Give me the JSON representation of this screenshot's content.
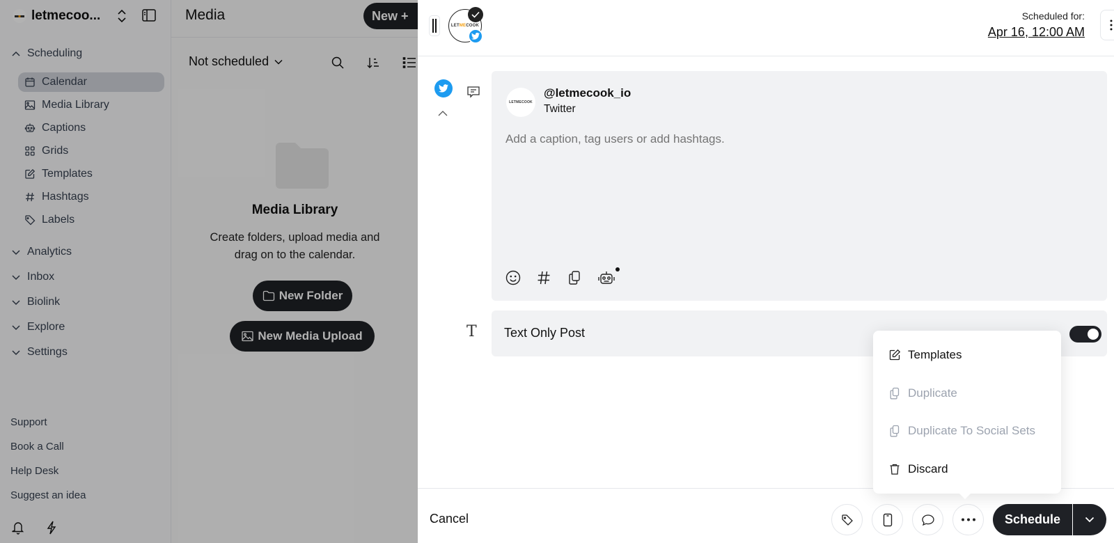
{
  "sidebar": {
    "workspace_name": "letmecoo...",
    "groups": {
      "scheduling": "Scheduling",
      "analytics": "Analytics",
      "inbox": "Inbox",
      "biolink": "Biolink",
      "explore": "Explore",
      "settings": "Settings"
    },
    "scheduling_items": [
      {
        "label": "Calendar",
        "icon": "calendar-icon",
        "active": true
      },
      {
        "label": "Media Library",
        "icon": "image-icon"
      },
      {
        "label": "Captions",
        "icon": "robot-icon"
      },
      {
        "label": "Grids",
        "icon": "grid-icon"
      },
      {
        "label": "Templates",
        "icon": "edit-icon"
      },
      {
        "label": "Hashtags",
        "icon": "hash-icon"
      },
      {
        "label": "Labels",
        "icon": "tag-icon"
      }
    ],
    "footer_links": [
      "Support",
      "Book a Call",
      "Help Desk",
      "Suggest an idea"
    ]
  },
  "media_panel": {
    "title": "Media",
    "new_button": "New +",
    "filter": "Not scheduled",
    "empty_title": "Media Library",
    "empty_desc": "Create folders, upload media and drag on to the calendar.",
    "new_folder": "New Folder",
    "new_media_upload": "New Media Upload"
  },
  "drawer": {
    "account_logo_text": "LETMECOOK",
    "scheduled_for_label": "Scheduled for:",
    "scheduled_for_value": "Apr 16, 12:00 AM",
    "post": {
      "handle": "@letmecook_io",
      "network": "Twitter",
      "caption_value": "",
      "caption_placeholder": "Add a caption, tag users or add hashtags."
    },
    "text_only_post": {
      "label": "Text Only Post",
      "enabled": true
    },
    "footer": {
      "cancel": "Cancel",
      "schedule": "Schedule"
    }
  },
  "more_menu": {
    "items": [
      {
        "label": "Templates",
        "icon": "edit-icon",
        "disabled": false
      },
      {
        "label": "Duplicate",
        "icon": "copy-icon",
        "disabled": true
      },
      {
        "label": "Duplicate To Social Sets",
        "icon": "copy-icon",
        "disabled": true
      },
      {
        "label": "Discard",
        "icon": "trash-icon",
        "disabled": false
      }
    ]
  },
  "colors": {
    "twitter_blue": "#1d9bf0",
    "primary_dark": "#1f2126",
    "editor_bg": "#f1f2f4"
  }
}
